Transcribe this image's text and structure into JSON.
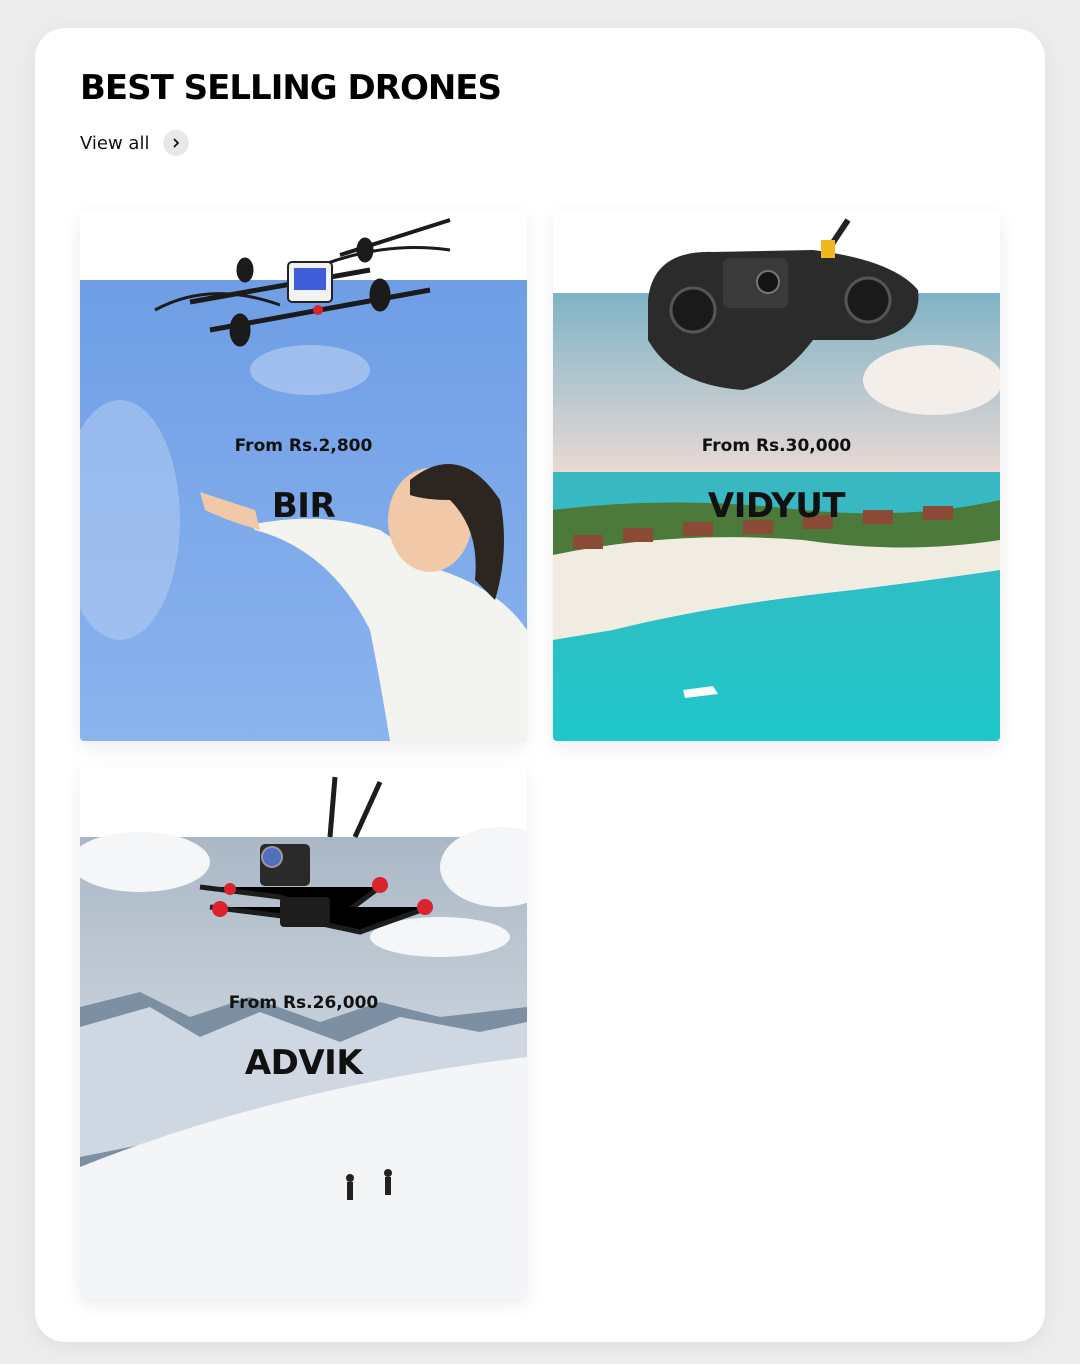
{
  "section": {
    "title": "BEST SELLING DRONES",
    "view_all_label": "View all",
    "view_all_icon": "chevron-right-icon"
  },
  "products": [
    {
      "price_label": "From Rs.2,800",
      "name": "BIR",
      "background": "sky-child-pointing"
    },
    {
      "price_label": "From Rs.30,000",
      "name": "VIDYUT",
      "background": "tropical-island-beach"
    },
    {
      "price_label": "From Rs.26,000",
      "name": "ADVIK",
      "background": "snowy-mountains"
    }
  ],
  "colors": {
    "page_bg": "#ececec",
    "panel_bg": "#ffffff",
    "text": "#111111"
  }
}
